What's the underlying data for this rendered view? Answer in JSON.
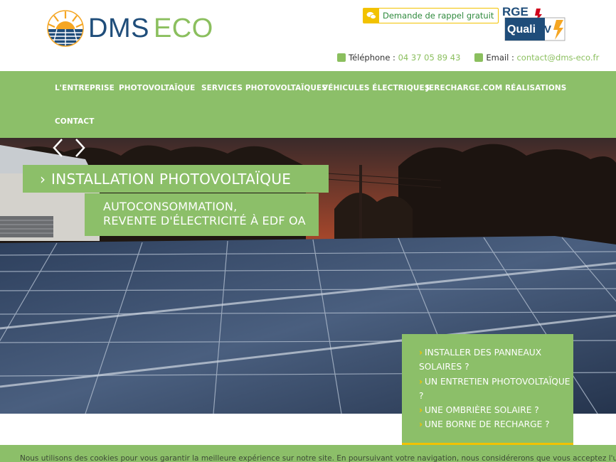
{
  "header": {
    "brand_main": "DMS",
    "brand_sub": "ECO",
    "callback_label": "Demande de rappel gratuit",
    "rge_top": "RGE",
    "rge_bottom": "Quali",
    "rge_pv": "PV",
    "phone_label": "Téléphone :",
    "phone_value": "04 37 05 89 43",
    "email_label": "Email :",
    "email_value": "contact@dms-eco.fr"
  },
  "nav": {
    "items": [
      "L'ENTREPRISE",
      "PHOTOVOLTAÏQUE",
      "SERVICES PHOTOVOLTAÏQUES",
      "VÉHICULES ÉLECTRIQUES",
      "JERECHARGE.COM",
      "RÉALISATIONS",
      "CONTACT"
    ]
  },
  "hero": {
    "title": "INSTALLATION PHOTOVOLTAÏQUE",
    "subtitle_line1": "AUTOCONSOMMATION,",
    "subtitle_line2": "REVENTE D'ÉLECTRICITÉ À EDF OA",
    "arrow_prev": "prev-arrow-icon",
    "arrow_next": "next-arrow-icon"
  },
  "side_links": [
    "INSTALLER DES PANNEAUX SOLAIRES ?",
    "UN ENTRETIEN PHOTOVOLTAÏQUE ?",
    "UNE OMBRIÈRE SOLAIRE ?",
    "UNE BORNE DE RECHARGE ?"
  ],
  "cookie": {
    "text": "Nous utilisons des cookies pour vous garantir la meilleure expérience sur notre site. En poursuivant votre navigation, nous considérerons que vous acceptez l'utilisation des cookies."
  },
  "colors": {
    "green": "#8cbf69",
    "blue": "#1f4d7a",
    "yellow": "#f2c200"
  }
}
